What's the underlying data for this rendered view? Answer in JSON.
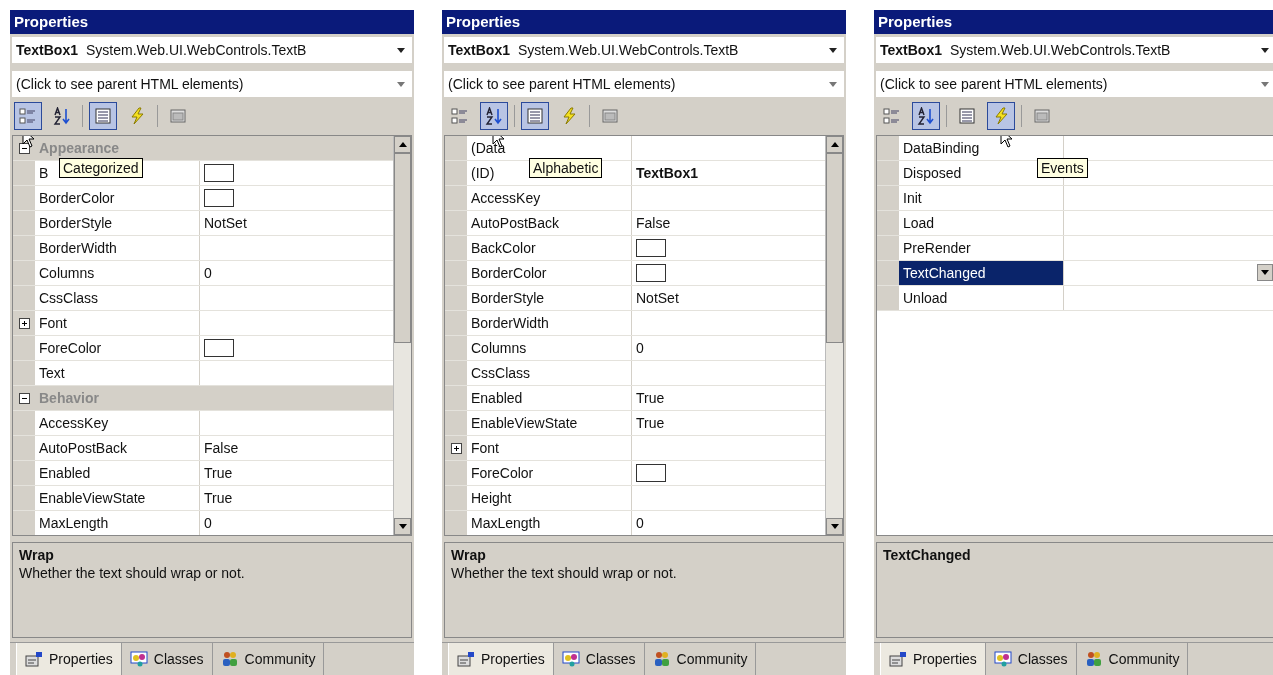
{
  "panels": [
    {
      "title": "Properties",
      "object_name": "TextBox1",
      "object_type": "System.Web.UI.WebControls.TextB",
      "parent_selector": "(Click to see parent HTML elements)",
      "has_scrollbar": true,
      "toolbar": [
        {
          "kind": "categorized",
          "selected": true,
          "tooltip": "Categorized"
        },
        {
          "kind": "alphabetic",
          "selected": false
        },
        {
          "kind": "properties",
          "selected": true
        },
        {
          "kind": "events",
          "selected": false
        },
        {
          "kind": "pages",
          "selected": false
        }
      ],
      "rows": [
        {
          "kind": "category",
          "name": "Appearance",
          "expanded": true
        },
        {
          "kind": "color",
          "name": "B"
        },
        {
          "kind": "color",
          "name": "BorderColor"
        },
        {
          "kind": "property",
          "name": "BorderStyle",
          "value": "NotSet"
        },
        {
          "kind": "property",
          "name": "BorderWidth"
        },
        {
          "kind": "property",
          "name": "Columns",
          "value": "0"
        },
        {
          "kind": "property",
          "name": "CssClass"
        },
        {
          "kind": "property",
          "name": "Font",
          "expanded": false
        },
        {
          "kind": "color",
          "name": "ForeColor"
        },
        {
          "kind": "property",
          "name": "Text"
        },
        {
          "kind": "category",
          "name": "Behavior",
          "expanded": true
        },
        {
          "kind": "property",
          "name": "AccessKey"
        },
        {
          "kind": "property",
          "name": "AutoPostBack",
          "value": "False"
        },
        {
          "kind": "property",
          "name": "Enabled",
          "value": "True"
        },
        {
          "kind": "property",
          "name": "EnableViewState",
          "value": "True"
        },
        {
          "kind": "property",
          "name": "MaxLength",
          "value": "0"
        }
      ],
      "description": {
        "title": "Wrap",
        "text": "Whether the text should wrap or not."
      },
      "tabs": [
        {
          "label": "Properties",
          "selected": true
        },
        {
          "label": "Classes",
          "selected": false
        },
        {
          "label": "Community",
          "selected": false
        }
      ]
    },
    {
      "title": "Properties",
      "object_name": "TextBox1",
      "object_type": "System.Web.UI.WebControls.TextB",
      "parent_selector": "(Click to see parent HTML elements)",
      "has_scrollbar": true,
      "toolbar": [
        {
          "kind": "categorized",
          "selected": false
        },
        {
          "kind": "alphabetic",
          "selected": true,
          "tooltip": "Alphabetic"
        },
        {
          "kind": "properties",
          "selected": true
        },
        {
          "kind": "events",
          "selected": false
        },
        {
          "kind": "pages",
          "selected": false
        }
      ],
      "rows": [
        {
          "kind": "property",
          "name": "(Data"
        },
        {
          "kind": "bold",
          "name": "(ID)",
          "value": "TextBox1"
        },
        {
          "kind": "property",
          "name": "AccessKey"
        },
        {
          "kind": "property",
          "name": "AutoPostBack",
          "value": "False"
        },
        {
          "kind": "color",
          "name": "BackColor"
        },
        {
          "kind": "color",
          "name": "BorderColor"
        },
        {
          "kind": "property",
          "name": "BorderStyle",
          "value": "NotSet"
        },
        {
          "kind": "property",
          "name": "BorderWidth"
        },
        {
          "kind": "property",
          "name": "Columns",
          "value": "0"
        },
        {
          "kind": "property",
          "name": "CssClass"
        },
        {
          "kind": "property",
          "name": "Enabled",
          "value": "True"
        },
        {
          "kind": "property",
          "name": "EnableViewState",
          "value": "True"
        },
        {
          "kind": "property",
          "name": "Font",
          "expanded": false
        },
        {
          "kind": "color",
          "name": "ForeColor"
        },
        {
          "kind": "property",
          "name": "Height"
        },
        {
          "kind": "property",
          "name": "MaxLength",
          "value": "0"
        }
      ],
      "description": {
        "title": "Wrap",
        "text": "Whether the text should wrap or not."
      },
      "tabs": [
        {
          "label": "Properties",
          "selected": true
        },
        {
          "label": "Classes",
          "selected": false
        },
        {
          "label": "Community",
          "selected": false
        }
      ]
    },
    {
      "title": "Properties",
      "object_name": "TextBox1",
      "object_type": "System.Web.UI.WebControls.TextB",
      "parent_selector": "(Click to see parent HTML elements)",
      "has_scrollbar": false,
      "toolbar": [
        {
          "kind": "categorized",
          "selected": false
        },
        {
          "kind": "alphabetic",
          "selected": true
        },
        {
          "kind": "properties",
          "selected": false
        },
        {
          "kind": "events",
          "selected": true,
          "tooltip": "Events"
        },
        {
          "kind": "pages",
          "selected": false
        }
      ],
      "rows": [
        {
          "kind": "event",
          "name": "DataBinding",
          "selected": false
        },
        {
          "kind": "event",
          "name": "Disposed",
          "selected": false
        },
        {
          "kind": "event",
          "name": "Init",
          "selected": false
        },
        {
          "kind": "event",
          "name": "Load",
          "selected": false
        },
        {
          "kind": "event",
          "name": "PreRender",
          "selected": false
        },
        {
          "kind": "event",
          "name": "TextChanged",
          "selected": true
        },
        {
          "kind": "event",
          "name": "Unload",
          "selected": false
        }
      ],
      "description": {
        "title": "TextChanged"
      },
      "tabs": [
        {
          "label": "Properties",
          "selected": true
        },
        {
          "label": "Classes",
          "selected": false
        },
        {
          "label": "Community",
          "selected": false
        }
      ]
    }
  ]
}
